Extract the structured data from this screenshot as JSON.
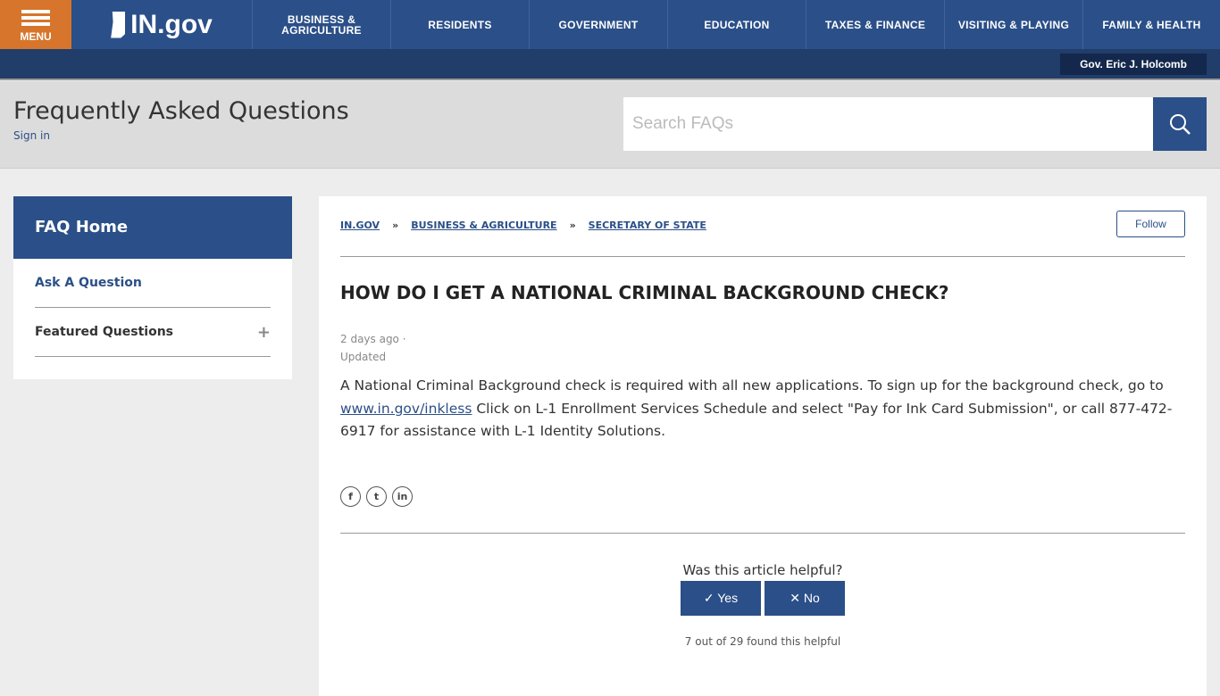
{
  "topbar": {
    "menu_label": "MENU",
    "logo_text": "IN.gov",
    "nav": [
      "BUSINESS & AGRICULTURE",
      "RESIDENTS",
      "GOVERNMENT",
      "EDUCATION",
      "TAXES & FINANCE",
      "VISITING & PLAYING",
      "FAMILY & HEALTH"
    ]
  },
  "subbar": {
    "governor": "Gov. Eric J. Holcomb"
  },
  "header": {
    "title": "Frequently Asked Questions",
    "signin": "Sign in",
    "search_placeholder": "Search FAQs"
  },
  "sidebar": {
    "home": "FAQ Home",
    "items": [
      {
        "label": "Ask A Question"
      },
      {
        "label": "Featured Questions",
        "icon": "+"
      }
    ]
  },
  "main": {
    "breadcrumbs": [
      "IN.GOV",
      "BUSINESS & AGRICULTURE",
      "SECRETARY OF STATE"
    ],
    "breadcrumb_sep": "»",
    "follow": "Follow",
    "title": "HOW DO I GET A NATIONAL CRIMINAL BACKGROUND CHECK?",
    "date": "2 days ago ·",
    "status": "Updated",
    "body_before": "A National Criminal Background check is required with all new applications. To sign up for the background check, go to ",
    "body_link": "www.in.gov/inkless",
    "body_after": " Click on L-1 Enrollment Services Schedule and select \"Pay for Ink Card Submission\", or call 877-472-6917 for assistance with L-1 Identity Solutions.",
    "social": [
      "f",
      "t",
      "in"
    ],
    "helpful_q": "Was this article helpful?",
    "yes": "✓  Yes",
    "no": "✕  No",
    "helpful_count": "7 out of 29 found this helpful"
  },
  "colors": {
    "brand": "#2b4f88",
    "menu": "#d6752b",
    "dark": "#213d69"
  }
}
